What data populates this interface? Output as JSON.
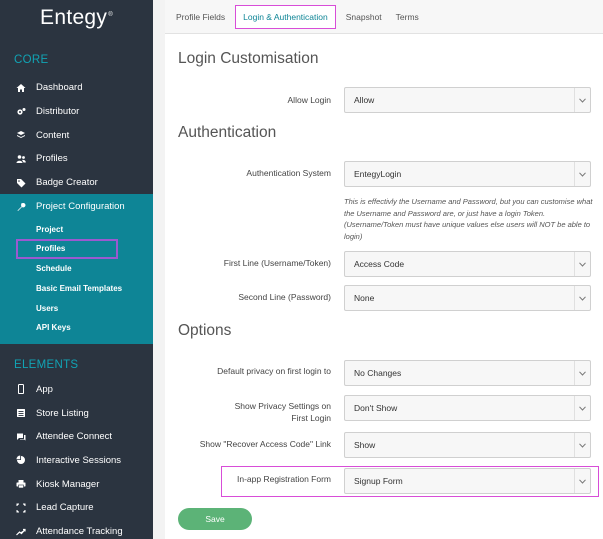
{
  "brand": {
    "logo_text": "Entegy",
    "logo_mark": "®"
  },
  "sidebar": {
    "core_title": "CORE",
    "core_items": [
      {
        "label": "Dashboard",
        "icon": "home-icon"
      },
      {
        "label": "Distributor",
        "icon": "gears-icon"
      },
      {
        "label": "Content",
        "icon": "layers-icon"
      },
      {
        "label": "Profiles",
        "icon": "users-icon"
      },
      {
        "label": "Badge Creator",
        "icon": "tag-icon"
      }
    ],
    "active_item": {
      "label": "Project Configuration",
      "icon": "wrench-icon"
    },
    "sub_items": [
      "Project",
      "Profiles",
      "Schedule",
      "Basic Email Templates",
      "Users",
      "API Keys"
    ],
    "selected_sub_item": "Profiles",
    "elements_title": "ELEMENTS",
    "element_items": [
      {
        "label": "App",
        "icon": "mobile-icon"
      },
      {
        "label": "Store Listing",
        "icon": "list-icon"
      },
      {
        "label": "Attendee Connect",
        "icon": "chat-icon"
      },
      {
        "label": "Interactive Sessions",
        "icon": "pie-icon"
      },
      {
        "label": "Kiosk Manager",
        "icon": "printer-icon"
      },
      {
        "label": "Lead Capture",
        "icon": "scan-icon"
      },
      {
        "label": "Attendance Tracking",
        "icon": "chart-line-icon"
      }
    ]
  },
  "tabs": [
    "Profile Fields",
    "Login & Authentication",
    "Snapshot",
    "Terms"
  ],
  "active_tab": "Login & Authentication",
  "login_section": {
    "heading": "Login Customisation",
    "allow_login_label": "Allow Login",
    "allow_login_value": "Allow"
  },
  "auth_section": {
    "heading": "Authentication",
    "system_label": "Authentication System",
    "system_value": "EntegyLogin",
    "help_text": "This is effectivly the Username and Password, but you can customise what the Username and Password are, or just have a login Token. (Username/Token must have unique values else users will NOT be able to login)",
    "first_line_label": "First Line (Username/Token)",
    "first_line_value": "Access Code",
    "second_line_label": "Second Line (Password)",
    "second_line_value": "None"
  },
  "options_section": {
    "heading": "Options",
    "privacy_label": "Default privacy on first login to",
    "privacy_value": "No Changes",
    "show_privacy_label_line1": "Show Privacy Settings on",
    "show_privacy_label_line2": "First Login",
    "show_privacy_value": "Don't Show",
    "recover_label": "Show \"Recover Access Code\" Link",
    "recover_value": "Show",
    "registration_label": "In-app Registration Form",
    "registration_value": "Signup Form"
  },
  "save_label": "Save",
  "colors": {
    "sidebar_bg": "#2b3440",
    "accent_teal": "#11a3b4",
    "active_bg": "#0e8596",
    "save_green": "#5cb377",
    "highlight": "#d84dd8"
  }
}
